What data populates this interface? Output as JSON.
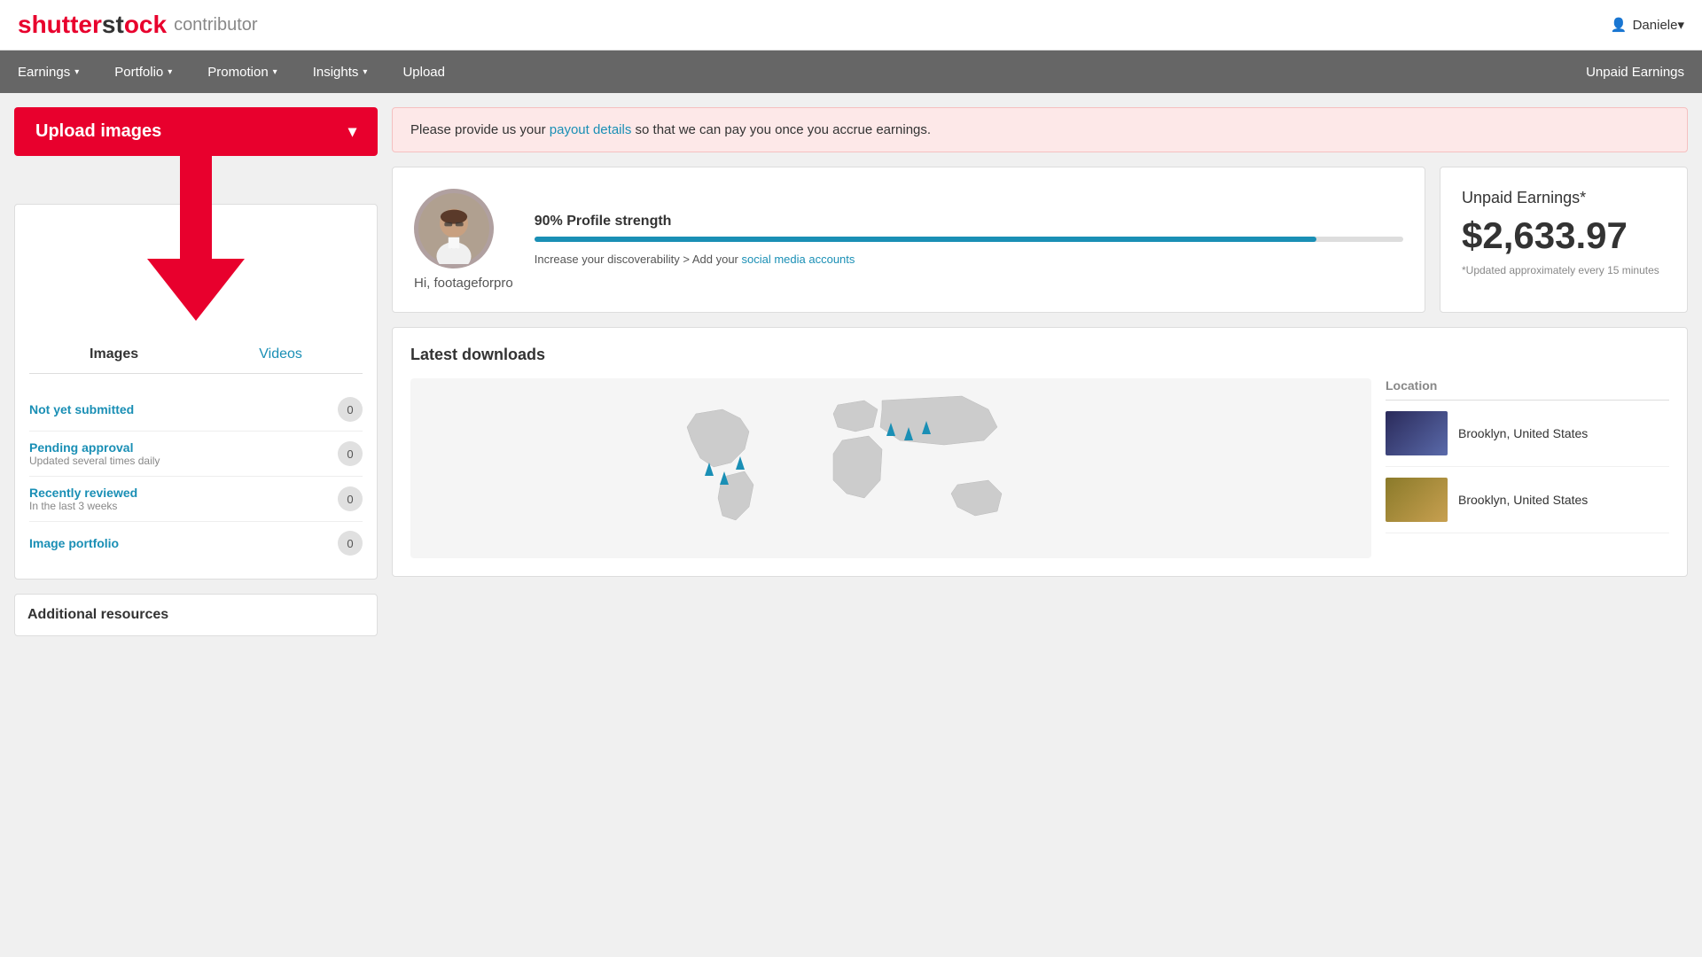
{
  "header": {
    "logo_shutter": "shutter",
    "logo_stock": "st",
    "logo_ock": "ock",
    "logo_contrib": "contributor",
    "user_label": "Daniele",
    "user_caret": "▾"
  },
  "nav": {
    "items": [
      {
        "label": "Earnings",
        "caret": "▾",
        "id": "earnings"
      },
      {
        "label": "Portfolio",
        "caret": "▾",
        "id": "portfolio"
      },
      {
        "label": "Promotion",
        "caret": "▾",
        "id": "promotion"
      },
      {
        "label": "Insights",
        "caret": "▾",
        "id": "insights"
      },
      {
        "label": "Upload",
        "caret": "",
        "id": "upload"
      }
    ],
    "unpaid_label": "Unpaid Earnings"
  },
  "upload_button": {
    "label": "Upload images",
    "chevron": "▾"
  },
  "image_tabs": {
    "tabs": [
      {
        "label": "Images",
        "active": true
      },
      {
        "label": "Videos",
        "active": false
      }
    ],
    "statuses": [
      {
        "label": "Not yet submitted",
        "sublabel": "",
        "count": "0"
      },
      {
        "label": "Pending approval",
        "sublabel": "Updated several times daily",
        "count": "0"
      },
      {
        "label": "Recently reviewed",
        "sublabel": "In the last 3 weeks",
        "count": "0"
      },
      {
        "label": "Image portfolio",
        "sublabel": "",
        "count": "0"
      }
    ]
  },
  "additional_resources": {
    "title": "Additional resources"
  },
  "alert": {
    "text_before": "Please provide us your ",
    "link_text": "payout details",
    "text_after": " so that we can pay you once you accrue earnings."
  },
  "profile": {
    "greeting": "Hi, footageforpro",
    "strength_label": "90% Profile strength",
    "strength_pct": 90,
    "tip_before": "Increase your discoverability > Add your ",
    "tip_link": "social media accounts"
  },
  "earnings": {
    "title": "Unpaid Earnings*",
    "amount": "$2,633.97",
    "note": "*Updated approximately every 15 minutes"
  },
  "downloads": {
    "title": "Latest downloads",
    "location_header": "Location",
    "locations": [
      {
        "label": "Brooklyn, United States"
      },
      {
        "label": "Brooklyn, United States"
      }
    ]
  }
}
